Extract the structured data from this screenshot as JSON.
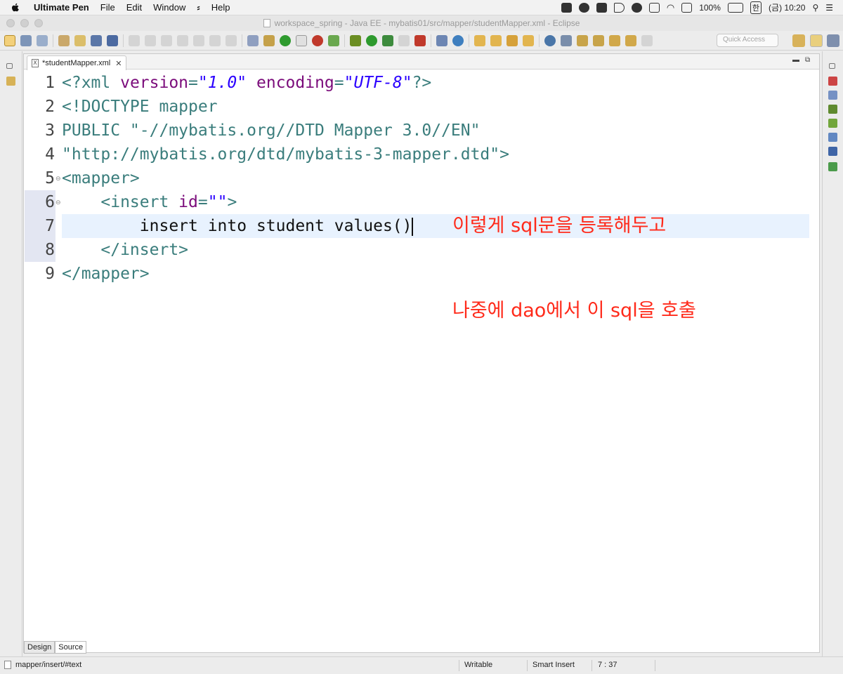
{
  "menubar": {
    "app_name": "Ultimate Pen",
    "items": [
      "File",
      "Edit",
      "Window",
      "Help"
    ],
    "battery": "100%",
    "ime": "한",
    "clock": "(금) 10:20"
  },
  "window": {
    "title": "workspace_spring - Java EE - mybatis01/src/mapper/studentMapper.xml - Eclipse"
  },
  "toolbar": {
    "quick_access_placeholder": "Quick Access"
  },
  "editor": {
    "tab_label": "*studentMapper.xml",
    "file_icon": "X",
    "lines": [
      {
        "n": "1",
        "parts": [
          [
            "tag",
            "<?xml "
          ],
          [
            "attr",
            "version"
          ],
          [
            "tag",
            "="
          ],
          [
            "str",
            "\"1.0\""
          ],
          [
            "plain",
            " "
          ],
          [
            "attr",
            "encoding"
          ],
          [
            "tag",
            "="
          ],
          [
            "str",
            "\"UTF-8\""
          ],
          [
            "tag",
            "?>"
          ]
        ]
      },
      {
        "n": "2",
        "parts": [
          [
            "dt",
            "<!DOCTYPE mapper"
          ]
        ]
      },
      {
        "n": "3",
        "parts": [
          [
            "dt",
            "PUBLIC \"-//mybatis.org//DTD Mapper 3.0//EN\""
          ]
        ]
      },
      {
        "n": "4",
        "parts": [
          [
            "dt",
            "\"http://mybatis.org/dtd/mybatis-3-mapper.dtd\">"
          ]
        ]
      },
      {
        "n": "5",
        "parts": [
          [
            "tag",
            "<mapper>"
          ]
        ]
      },
      {
        "n": "6",
        "parts": [
          [
            "plain",
            "    "
          ],
          [
            "tag",
            "<insert "
          ],
          [
            "attr",
            "id"
          ],
          [
            "tag",
            "="
          ],
          [
            "str",
            "\"\""
          ],
          [
            "tag",
            ">"
          ]
        ]
      },
      {
        "n": "7",
        "parts": [
          [
            "plain",
            "        insert into student values()"
          ]
        ]
      },
      {
        "n": "8",
        "parts": [
          [
            "plain",
            "    "
          ],
          [
            "tag",
            "</insert>"
          ]
        ]
      },
      {
        "n": "9",
        "parts": [
          [
            "tag",
            "</mapper>"
          ]
        ]
      }
    ],
    "annotation_1": "이렇게 sql문을 등록해두고",
    "annotation_2": "나중에 dao에서 이 sql을 호출",
    "bottom_tabs": [
      "Design",
      "Source"
    ]
  },
  "statusbar": {
    "path": "mapper/insert/#text",
    "writable": "Writable",
    "insert_mode": "Smart Insert",
    "position": "7 : 37"
  }
}
